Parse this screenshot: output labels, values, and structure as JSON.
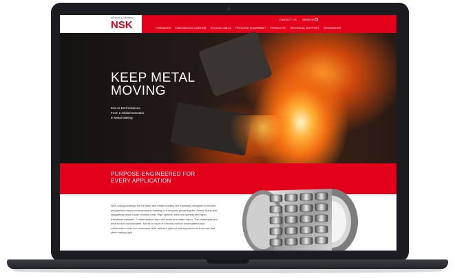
{
  "site": {
    "logo_tagline": "MOTION & CONTROL",
    "logo": "NSK",
    "contact_label": "CONTACT US",
    "search_label": "SEARCH",
    "search_icon": "search-icon",
    "nav": [
      "FURNACES",
      "CONTINUOUS CASTING",
      "ROLLING MILLS",
      "PROCESS EQUIPMENT",
      "PRODUCTS",
      "TECHNICAL SUPPORT",
      "RESOURCES"
    ]
  },
  "hero": {
    "title": "KEEP METAL MOVING",
    "subtitle_lines": [
      "End-to-End Solutions,",
      "From a Global Innovator",
      "in Metal Making."
    ]
  },
  "band": {
    "title": "PURPOSE-ENGINEERED FOR EVERY APPLICATION"
  },
  "content": {
    "paragraph": "NSK rolling bearings for the steel and metal industry are expressly designed to endure and perform beyond conventional thinking in a uniquely punishing life. Heavy loads and staggering shock loads. Intense heat. High speeds, ultra-low speeds and rapid transitions between. Contamination from mill scale and water vapor. The challenges are diverse and considerable, but as a result of intense product development and collaboration with our customers NSK delivers optimal bearing solutions from raw and steel making right"
  },
  "colors": {
    "brand_red": "#e2001a",
    "laptop_frame": "#1b1c1f"
  }
}
